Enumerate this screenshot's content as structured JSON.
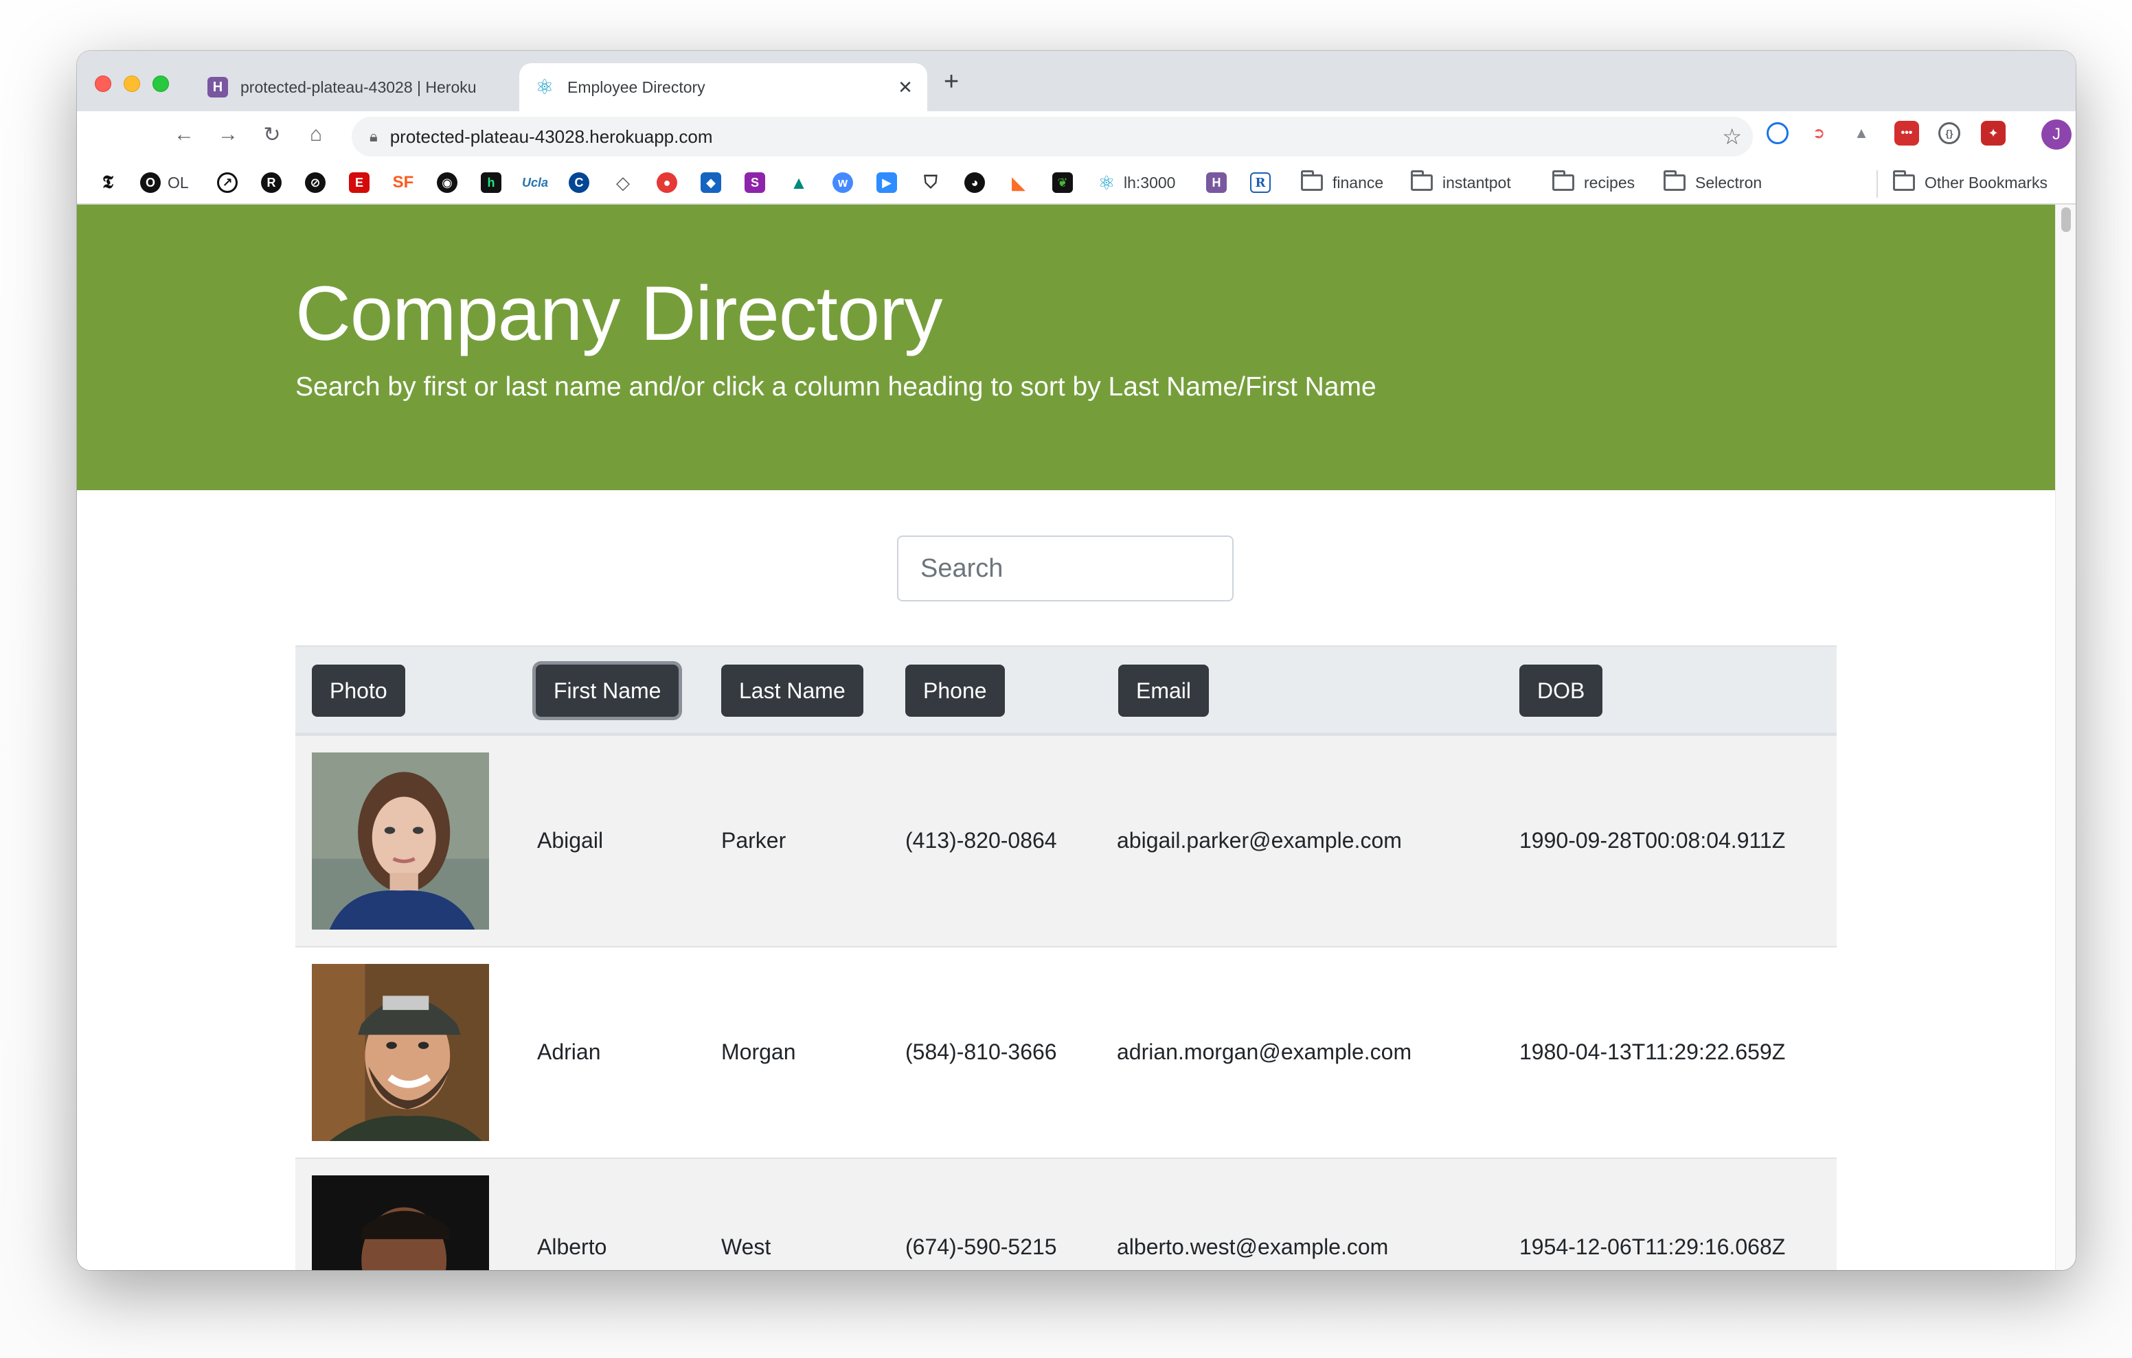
{
  "browser": {
    "tabs": [
      {
        "title": "protected-plateau-43028 | Heroku",
        "favicon": "heroku-icon",
        "active": false
      },
      {
        "title": "Employee Directory",
        "favicon": "react-icon",
        "active": true
      }
    ],
    "url": "protected-plateau-43028.herokuapp.com",
    "profile_initial": "J",
    "bookmarks": [
      {
        "label": "OL",
        "icon": "ol-icon"
      },
      {
        "label": "lh:3000",
        "icon": "react-icon"
      },
      {
        "label": "finance",
        "icon": "folder-icon"
      },
      {
        "label": "instantpot",
        "icon": "folder-icon"
      },
      {
        "label": "recipes",
        "icon": "folder-icon"
      },
      {
        "label": "Selectron",
        "icon": "folder-icon"
      },
      {
        "label": "Other Bookmarks",
        "icon": "folder-icon"
      }
    ]
  },
  "page": {
    "hero_title": "Company Directory",
    "hero_subtitle": "Search by first or last name and/or click a column heading to sort by Last Name/First Name",
    "hero_color": "#759e3b",
    "search_placeholder": "Search",
    "columns": [
      "Photo",
      "First Name",
      "Last Name",
      "Phone",
      "Email",
      "DOB"
    ],
    "employees": [
      {
        "first": "Abigail",
        "last": "Parker",
        "phone": "(413)-820-0864",
        "email": "abigail.parker@example.com",
        "dob": "1990-09-28T00:08:04.911Z"
      },
      {
        "first": "Adrian",
        "last": "Morgan",
        "phone": "(584)-810-3666",
        "email": "adrian.morgan@example.com",
        "dob": "1980-04-13T11:29:22.659Z"
      },
      {
        "first": "Alberto",
        "last": "West",
        "phone": "(674)-590-5215",
        "email": "alberto.west@example.com",
        "dob": "1954-12-06T11:29:16.068Z"
      }
    ]
  }
}
